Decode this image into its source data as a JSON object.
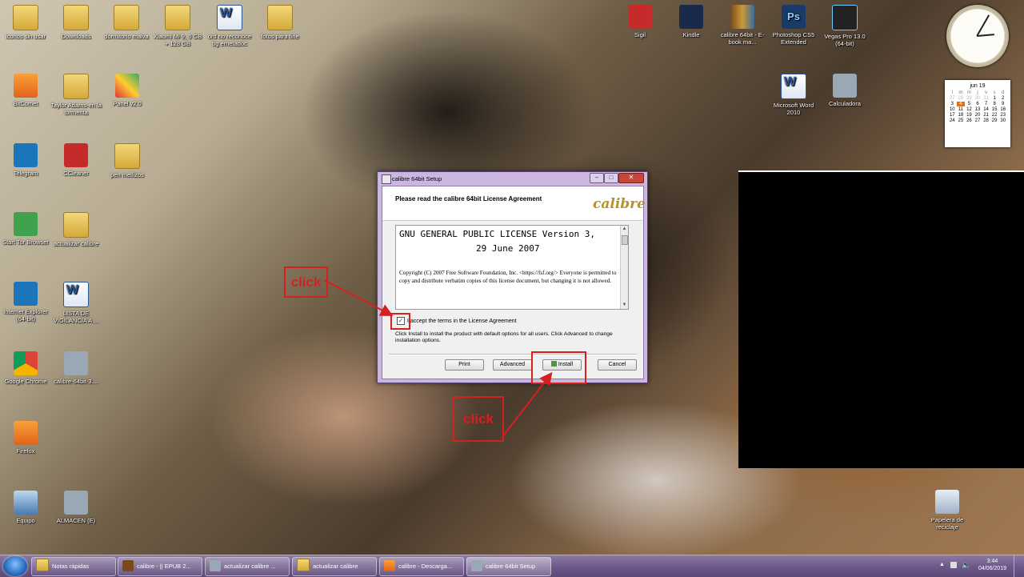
{
  "desktop_icons": [
    {
      "label": "iconos sin usar"
    },
    {
      "label": "Downloads"
    },
    {
      "label": "dormitorio malva"
    },
    {
      "label": "Xiaomi Mi 9, 6 GB + 128 GB"
    },
    {
      "label": "ord no reconoce bg ernetadoc"
    },
    {
      "label": "fotos para fine"
    },
    {
      "label": "Sigil"
    },
    {
      "label": "Kindle"
    },
    {
      "label": "calibre 64bit - E-book ma..."
    },
    {
      "label": "Photoshop CS5 Extended"
    },
    {
      "label": "Vegas Pro 13.0 (64-bit)"
    },
    {
      "label": "Microsoft Word 2010"
    },
    {
      "label": "Calculadora"
    },
    {
      "label": "BitComet"
    },
    {
      "label": "Taylor Adams-en la tormenta"
    },
    {
      "label": "Panel v2.0"
    },
    {
      "label": "Telegram"
    },
    {
      "label": "CCleaner"
    },
    {
      "label": "pen mellizos"
    },
    {
      "label": "Start Tor Browser"
    },
    {
      "label": "actualizar calibre"
    },
    {
      "label": "Internet Explorer (64-bit)"
    },
    {
      "label": "LISTA DE VIGILANCIA A ..."
    },
    {
      "label": "Google Chrome"
    },
    {
      "label": "calibre-64bit-3...."
    },
    {
      "label": "Firefox"
    },
    {
      "label": "Equipo"
    },
    {
      "label": "ALMACEN (E)"
    },
    {
      "label": "Papelera de reciclaje"
    }
  ],
  "gadgets": {
    "calendar_month": "jun 19",
    "calendar_days_header": [
      "l",
      "m",
      "m",
      "j",
      "v",
      "s",
      "d"
    ],
    "calendar_rows": [
      [
        "27",
        "28",
        "29",
        "30",
        "31",
        "1",
        "2"
      ],
      [
        "3",
        "4",
        "5",
        "6",
        "7",
        "8",
        "9"
      ],
      [
        "10",
        "11",
        "12",
        "13",
        "14",
        "15",
        "16"
      ],
      [
        "17",
        "18",
        "19",
        "20",
        "21",
        "22",
        "23"
      ],
      [
        "24",
        "25",
        "26",
        "27",
        "28",
        "29",
        "30"
      ]
    ],
    "calendar_today": "4"
  },
  "dialog": {
    "title": "calibre 64bit Setup",
    "header": "Please read the calibre 64bit License Agreement",
    "logo": "calibre",
    "license_title_line1": "GNU GENERAL PUBLIC LICENSE Version 3,",
    "license_title_line2": "29 June 2007",
    "license_body": "Copyright (C) 2007 Free Software Foundation, Inc. <https://fsf.org/> Everyone is permitted to copy and distribute verbatim copies of this license document, but changing it is not allowed.",
    "accept_label": "I accept the terms in the License Agreement",
    "accept_checked": true,
    "info_text": "Click Install to install the product with default options for all users. Click Advanced to change installation options.",
    "buttons": {
      "print": "Print",
      "advanced": "Advanced",
      "install": "Install",
      "cancel": "Cancel"
    }
  },
  "annotations": {
    "click1": "click",
    "click2": "click"
  },
  "taskbar": {
    "items": [
      {
        "label": "Notas rápidas"
      },
      {
        "label": "calibre - || EPUB 2..."
      },
      {
        "label": "actualizar calibre ..."
      },
      {
        "label": "actualizar calibre"
      },
      {
        "label": "calibre - Descarga..."
      },
      {
        "label": "calibre 64bit Setup",
        "active": true
      }
    ],
    "time": "3:44",
    "date": "04/06/2019"
  },
  "colors": {
    "annotation": "#d62020",
    "taskbar": "#6e5a8a"
  }
}
